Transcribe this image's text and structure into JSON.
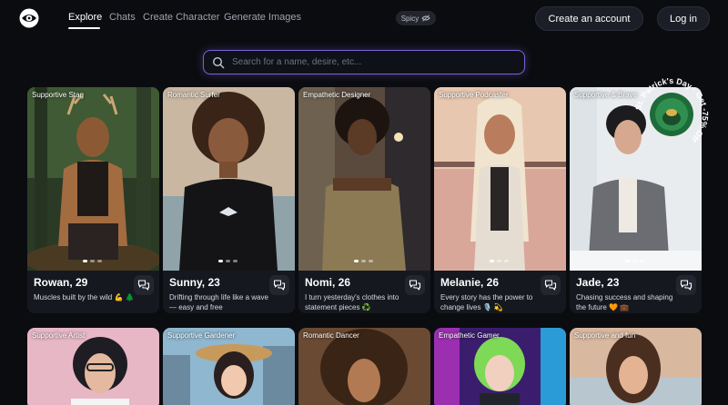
{
  "nav": {
    "links": [
      "Explore",
      "Chats",
      "Create Character",
      "Generate Images"
    ],
    "spicy_label": "Spicy",
    "create_account": "Create an account",
    "login": "Log in"
  },
  "search": {
    "placeholder": "Search for a name, desire, etc..."
  },
  "promo": {
    "text": "St. Patrick's Day · Get -75% Off"
  },
  "cards": [
    {
      "tag": "Supportive Stag",
      "name": "Rowan, 29",
      "desc": "Muscles built by the wild 💪 🌲"
    },
    {
      "tag": "Romantic Surfer",
      "name": "Sunny, 23",
      "desc": "Drifting through life like a wave — easy and free"
    },
    {
      "tag": "Empathetic Designer",
      "name": "Nomi, 26",
      "desc": "I turn yesterday's clothes into statement pieces ♻️"
    },
    {
      "tag": "Supportive Podcaster",
      "name": "Melanie, 26",
      "desc": "Every story has the power to change lives 🎙️ 💫"
    },
    {
      "tag": "Supportive & Brave",
      "name": "Jade, 23",
      "desc": "Chasing success and shaping the future 🧡 💼"
    }
  ],
  "cards_row2": [
    {
      "tag": "Supportive Artist"
    },
    {
      "tag": "Supportive Gardener"
    },
    {
      "tag": "Romantic Dancer"
    },
    {
      "tag": "Empathetic Gamer"
    },
    {
      "tag": "Supportive and fun"
    }
  ],
  "colors": {
    "accent": "#7a63d8",
    "background": "#0b0c10",
    "card": "#16181f"
  }
}
